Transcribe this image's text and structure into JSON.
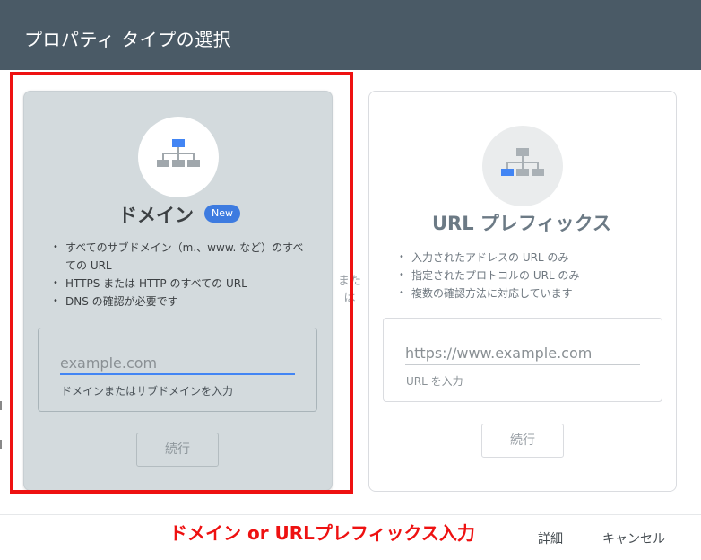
{
  "dialog": {
    "title": "プロパティ タイプの選択"
  },
  "domain_card": {
    "icon": "sitemap-icon",
    "title": "ドメイン",
    "badge": "New",
    "features": [
      "すべてのサブドメイン（m.、www. など）のすべての URL",
      "HTTPS または HTTP のすべての URL",
      "DNS の確認が必要です"
    ],
    "input": {
      "value": "",
      "placeholder": "example.com",
      "hint": "ドメインまたはサブドメインを入力"
    },
    "continue_label": "続行"
  },
  "separator": {
    "label": "または"
  },
  "url_card": {
    "icon": "sitemap-icon",
    "title": "URL プレフィックス",
    "features": [
      "入力されたアドレスの URL のみ",
      "指定されたプロトコルの URL のみ",
      "複数の確認方法に対応しています"
    ],
    "input": {
      "value": "",
      "placeholder": "https://www.example.com",
      "hint": "URL を入力"
    },
    "continue_label": "続行"
  },
  "annotation": {
    "text": "ドメイン or URLプレフィックス入力",
    "color": "#ee1111"
  },
  "footer": {
    "details_label": "詳細",
    "cancel_label": "キャンセル"
  },
  "colors": {
    "header": "#4a5a66",
    "accent": "#4285f4",
    "badge": "#3d7be0",
    "highlight": "#ee1111"
  }
}
